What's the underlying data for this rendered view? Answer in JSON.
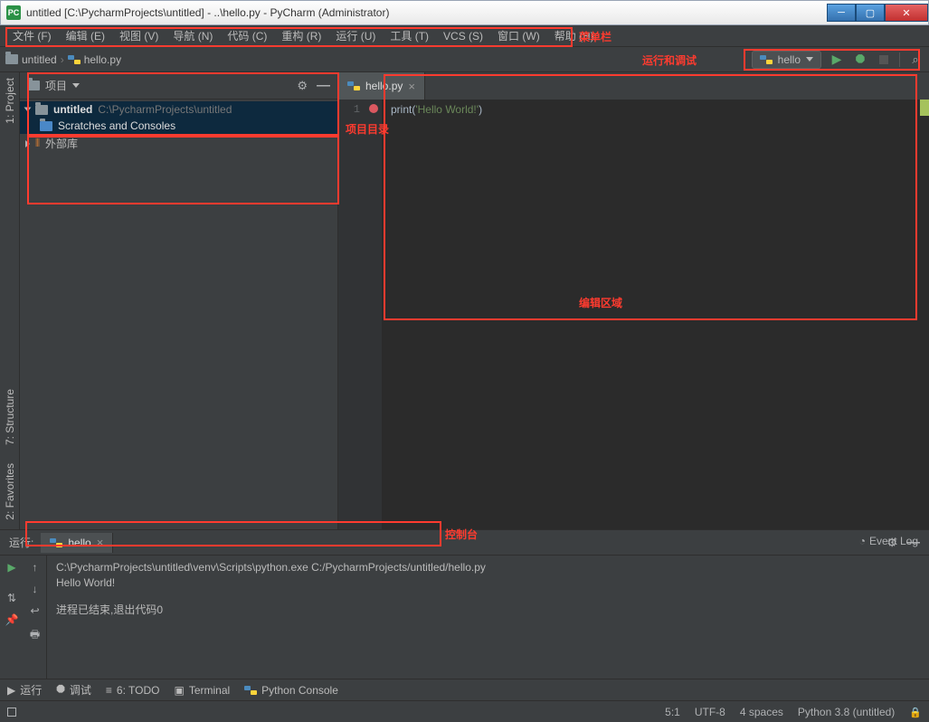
{
  "window": {
    "icon_text": "PC",
    "title": "untitled [C:\\PycharmProjects\\untitled] - ..\\hello.py - PyCharm (Administrator)"
  },
  "menubar": {
    "file": "文件 (F)",
    "edit": "编辑 (E)",
    "view": "视图 (V)",
    "navigate": "导航 (N)",
    "code": "代码 (C)",
    "refactor": "重构 (R)",
    "run": "运行 (U)",
    "tools": "工具 (T)",
    "vcs": "VCS (S)",
    "window": "窗口 (W)",
    "help": "帮助 (H)"
  },
  "annotations": {
    "menubar": "菜单栏",
    "run_debug": "运行和调试",
    "project_dir": "项目目录",
    "editor_area": "编辑区域",
    "console": "控制台"
  },
  "breadcrumb": {
    "project": "untitled",
    "file": "hello.py"
  },
  "run_config": {
    "selected": "hello"
  },
  "left_gutter": {
    "project": "1: Project",
    "structure": "7: Structure",
    "favorites": "2: Favorites"
  },
  "project_pane": {
    "title": "项目",
    "items": {
      "root": "untitled",
      "root_path": "C:\\PycharmProjects\\untitled",
      "scratches": "Scratches and Consoles",
      "external": "外部库"
    }
  },
  "editor": {
    "tab": "hello.py",
    "line_number": "1",
    "code_func": "print",
    "code_paren_open": "(",
    "code_str": "'Hello World!'",
    "code_paren_close": ")"
  },
  "run_panel": {
    "title": "运行:",
    "tab": "hello",
    "lines": {
      "cmd": "C:\\PycharmProjects\\untitled\\venv\\Scripts\\python.exe C:/PycharmProjects/untitled/hello.py",
      "out": "Hello World!",
      "exit": "进程已结束,退出代码0"
    }
  },
  "bottom_toolbar": {
    "run": "运行",
    "debug": "调试",
    "todo": "6: TODO",
    "terminal": "Terminal",
    "pyconsole": "Python Console"
  },
  "status": {
    "event_log": "Event Log",
    "position": "5:1",
    "encoding": "UTF-8",
    "indent": "4 spaces",
    "interpreter": "Python 3.8 (untitled)"
  }
}
